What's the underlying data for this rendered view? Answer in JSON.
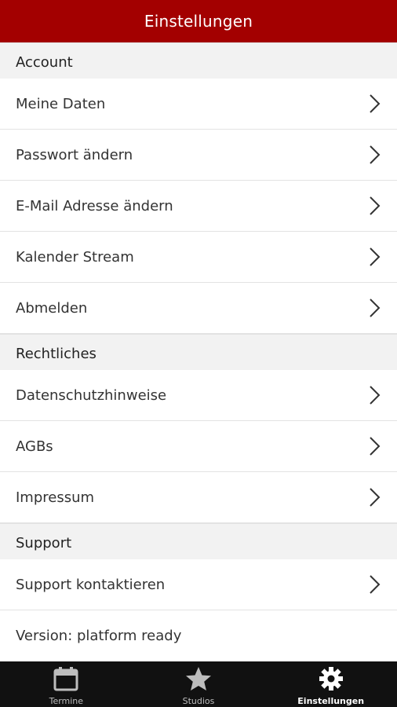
{
  "header": {
    "title": "Einstellungen"
  },
  "sections": [
    {
      "title": "Account",
      "items": [
        {
          "label": "Meine Daten",
          "chevron": true
        },
        {
          "label": "Passwort ändern",
          "chevron": true
        },
        {
          "label": "E-Mail Adresse ändern",
          "chevron": true
        },
        {
          "label": "Kalender Stream",
          "chevron": true
        },
        {
          "label": "Abmelden",
          "chevron": true
        }
      ]
    },
    {
      "title": "Rechtliches",
      "items": [
        {
          "label": "Datenschutzhinweise",
          "chevron": true
        },
        {
          "label": "AGBs",
          "chevron": true
        },
        {
          "label": "Impressum",
          "chevron": true
        }
      ]
    },
    {
      "title": "Support",
      "items": [
        {
          "label": "Support kontaktieren",
          "chevron": true
        },
        {
          "label": "Version: platform ready",
          "chevron": false
        }
      ]
    }
  ],
  "tabbar": {
    "tabs": [
      {
        "label": "Termine",
        "icon": "calendar-icon",
        "active": false
      },
      {
        "label": "Studios",
        "icon": "star-icon",
        "active": false
      },
      {
        "label": "Einstellungen",
        "icon": "gear-icon",
        "active": true
      }
    ]
  },
  "colors": {
    "header_bg": "#a30000",
    "tabbar_bg": "#111111",
    "section_bg": "#f2f2f2"
  }
}
